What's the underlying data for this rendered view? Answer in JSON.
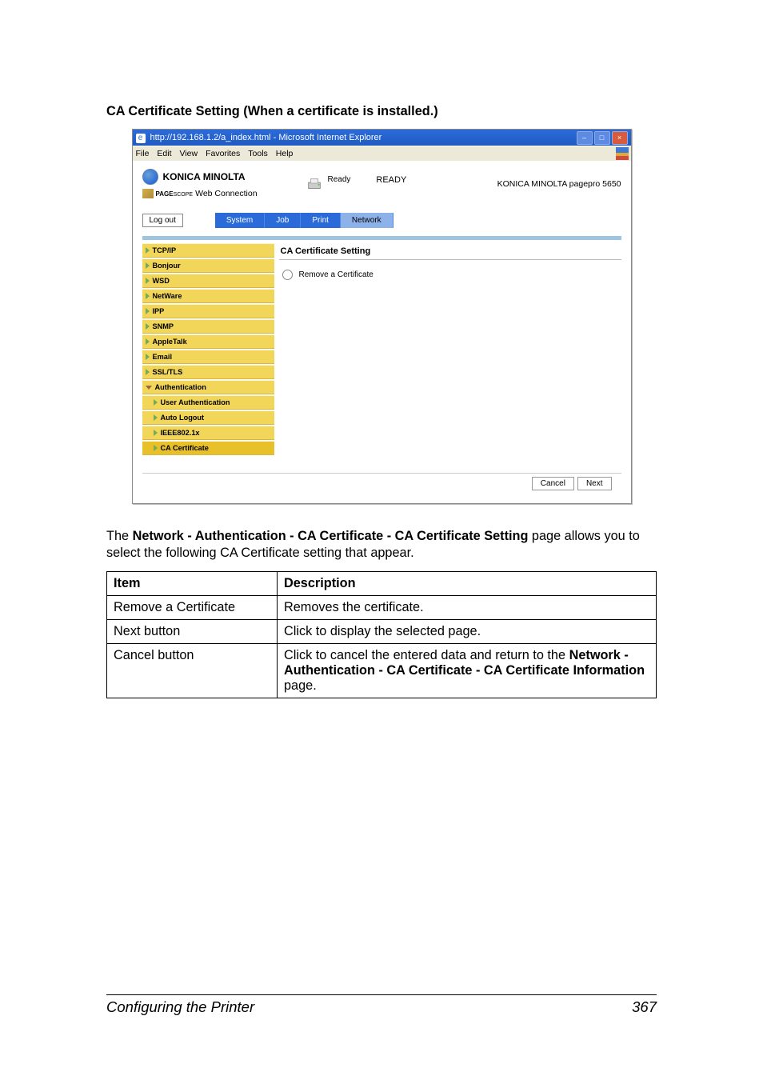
{
  "heading": "CA Certificate Setting (When a certificate is installed.)",
  "window": {
    "title": "http://192.168.1.2/a_index.html - Microsoft Internet Explorer",
    "menus": [
      "File",
      "Edit",
      "View",
      "Favorites",
      "Tools",
      "Help"
    ]
  },
  "header": {
    "brand": "KONICA MINOLTA",
    "subbrand": "PageScope Web Connection",
    "ready_small": "Ready",
    "ready_big": "READY",
    "product": "KONICA MINOLTA pagepro 5650"
  },
  "logout": "Log out",
  "tabs": [
    {
      "label": "System",
      "active": false
    },
    {
      "label": "Job",
      "active": false
    },
    {
      "label": "Print",
      "active": false
    },
    {
      "label": "Network",
      "active": true
    }
  ],
  "sidebar": [
    {
      "label": "TCP/IP",
      "sub": false
    },
    {
      "label": "Bonjour",
      "sub": false
    },
    {
      "label": "WSD",
      "sub": false
    },
    {
      "label": "NetWare",
      "sub": false
    },
    {
      "label": "IPP",
      "sub": false
    },
    {
      "label": "SNMP",
      "sub": false
    },
    {
      "label": "AppleTalk",
      "sub": false
    },
    {
      "label": "Email",
      "sub": false
    },
    {
      "label": "SSL/TLS",
      "sub": false
    },
    {
      "label": "Authentication",
      "sub": false,
      "expanded": true
    },
    {
      "label": "User Authentication",
      "sub": true
    },
    {
      "label": "Auto Logout",
      "sub": true
    },
    {
      "label": "IEEE802.1x",
      "sub": true
    },
    {
      "label": "CA Certificate",
      "sub": true,
      "active": true
    }
  ],
  "panel": {
    "title": "CA Certificate Setting",
    "option": "Remove a Certificate"
  },
  "buttons": {
    "cancel": "Cancel",
    "next": "Next"
  },
  "paragraph": {
    "pre": "The ",
    "bold": "Network - Authentication - CA Certificate - CA Certificate Setting",
    "post": " page allows you to select the following CA Certificate setting that appear."
  },
  "table": {
    "head": {
      "c1": "Item",
      "c2": "Description"
    },
    "rows": [
      {
        "c1": "Remove a Certificate",
        "c2": "Removes the certificate."
      },
      {
        "c1": "Next button",
        "c2": "Click to display the selected page."
      },
      {
        "c1": "Cancel button",
        "c2_pre": "Click to cancel the entered data and return to the ",
        "c2_bold": "Network - Authentication - CA Certificate - CA Certificate Information",
        "c2_post": " page."
      }
    ]
  },
  "footer": {
    "title": "Configuring the Printer",
    "page": "367"
  }
}
